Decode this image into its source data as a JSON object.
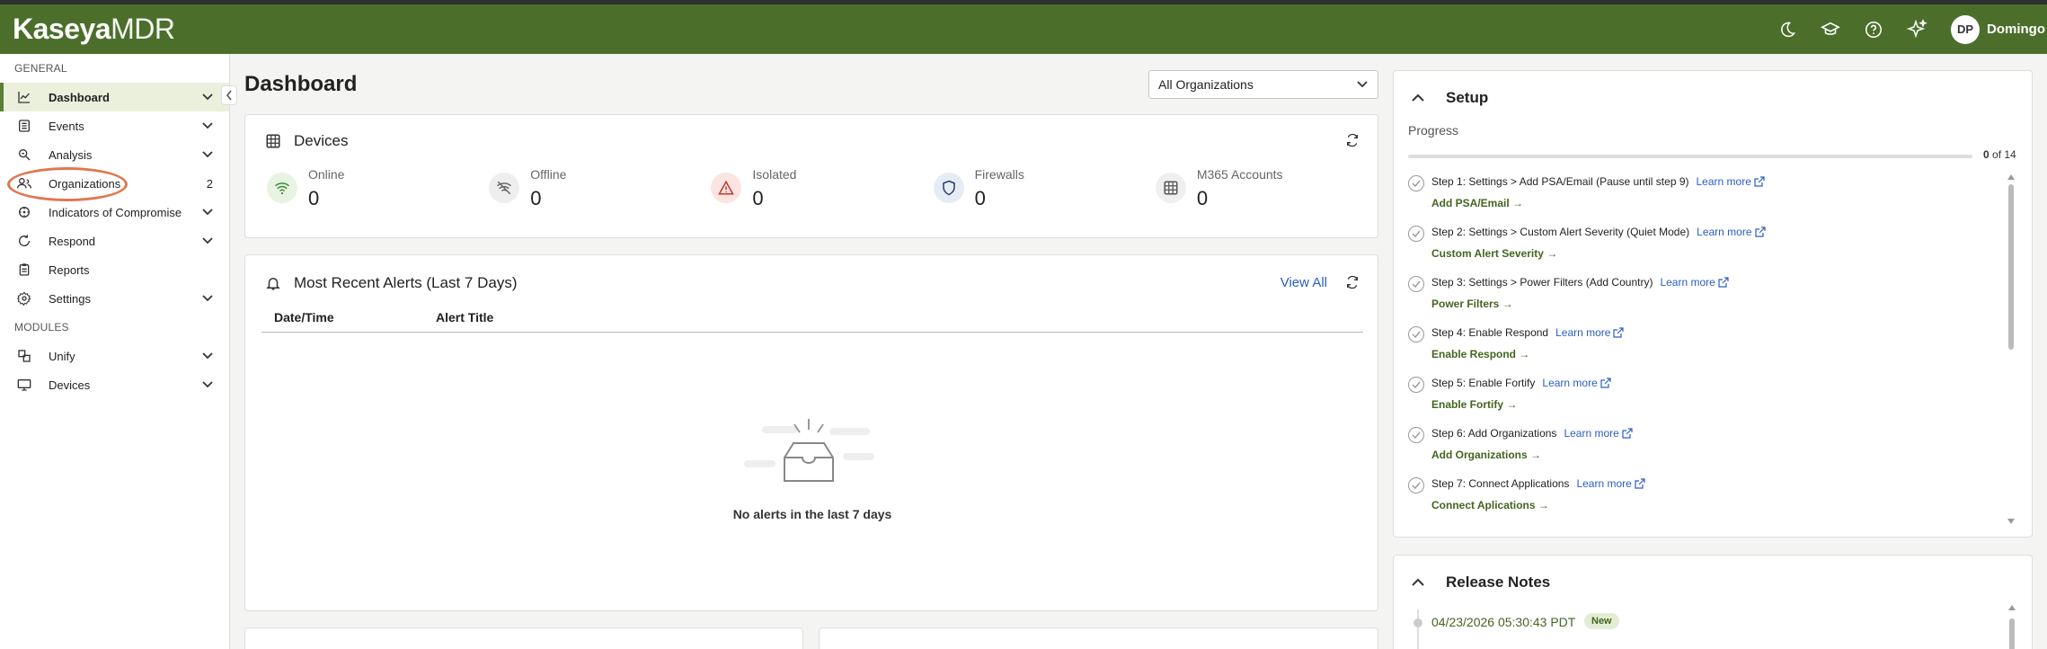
{
  "app": {
    "logo_bold": "Kaseya",
    "logo_light": "MDR",
    "user_initials": "DP",
    "user_name": "Domingo",
    "brand_color": "#4b6f2b",
    "accent_link": "#2a5dc7"
  },
  "top_icons": [
    "moon-icon",
    "graduation-cap-icon",
    "help-icon",
    "sparkle-icon"
  ],
  "sidebar": {
    "general_label": "GENERAL",
    "modules_label": "MODULES",
    "general_items": [
      {
        "label": "Dashboard",
        "icon": "chart-line-icon",
        "active": true,
        "chevron": true
      },
      {
        "label": "Events",
        "icon": "list-icon",
        "chevron": true
      },
      {
        "label": "Analysis",
        "icon": "magnify-icon",
        "chevron": true
      },
      {
        "label": "Organizations",
        "icon": "people-icon",
        "count": "2"
      },
      {
        "label": "Indicators of Compromise",
        "icon": "indicator-icon",
        "chevron": true
      },
      {
        "label": "Respond",
        "icon": "respond-icon",
        "chevron": true
      },
      {
        "label": "Reports",
        "icon": "clipboard-icon"
      },
      {
        "label": "Settings",
        "icon": "gear-icon",
        "chevron": true
      }
    ],
    "module_items": [
      {
        "label": "Unify",
        "icon": "unify-icon",
        "chevron": true
      },
      {
        "label": "Devices",
        "icon": "monitor-icon",
        "chevron": true
      }
    ]
  },
  "main": {
    "title": "Dashboard",
    "org_select_value": "All Organizations",
    "devices": {
      "title": "Devices",
      "stats": [
        {
          "label": "Online",
          "value": "0",
          "icon": "wifi-icon"
        },
        {
          "label": "Offline",
          "value": "0",
          "icon": "wifi-off-icon"
        },
        {
          "label": "Isolated",
          "value": "0",
          "icon": "warning-icon"
        },
        {
          "label": "Firewalls",
          "value": "0",
          "icon": "shield-icon"
        },
        {
          "label": "M365 Accounts",
          "value": "0",
          "icon": "grid-icon"
        }
      ]
    },
    "alerts": {
      "title": "Most Recent Alerts (Last 7 Days)",
      "view_all": "View All",
      "col_date": "Date/Time",
      "col_title": "Alert Title",
      "empty_text": "No alerts in the last 7 days"
    }
  },
  "setup": {
    "title": "Setup",
    "progress_label": "Progress",
    "progress_done": "0",
    "progress_of": "of 14",
    "progress_fraction": 0,
    "learn_more": "Learn more",
    "steps": [
      {
        "title": "Step 1: Settings > Add PSA/Email (Pause until step 9)",
        "action": "Add PSA/Email →"
      },
      {
        "title": "Step 2: Settings > Custom Alert Severity (Quiet Mode)",
        "action": "Custom Alert Severity →"
      },
      {
        "title": "Step 3: Settings > Power Filters (Add Country)",
        "action": "Power Filters →"
      },
      {
        "title": "Step 4: Enable Respond",
        "action": "Enable Respond →"
      },
      {
        "title": "Step 5: Enable Fortify",
        "action": "Enable Fortify →"
      },
      {
        "title": "Step 6: Add Organizations",
        "action": "Add Organizations →"
      },
      {
        "title": "Step 7: Connect Applications",
        "action": "Connect Aplications →"
      }
    ]
  },
  "release_notes": {
    "title": "Release Notes",
    "date": "04/23/2026 05:30:43 PDT",
    "badge": "New"
  }
}
